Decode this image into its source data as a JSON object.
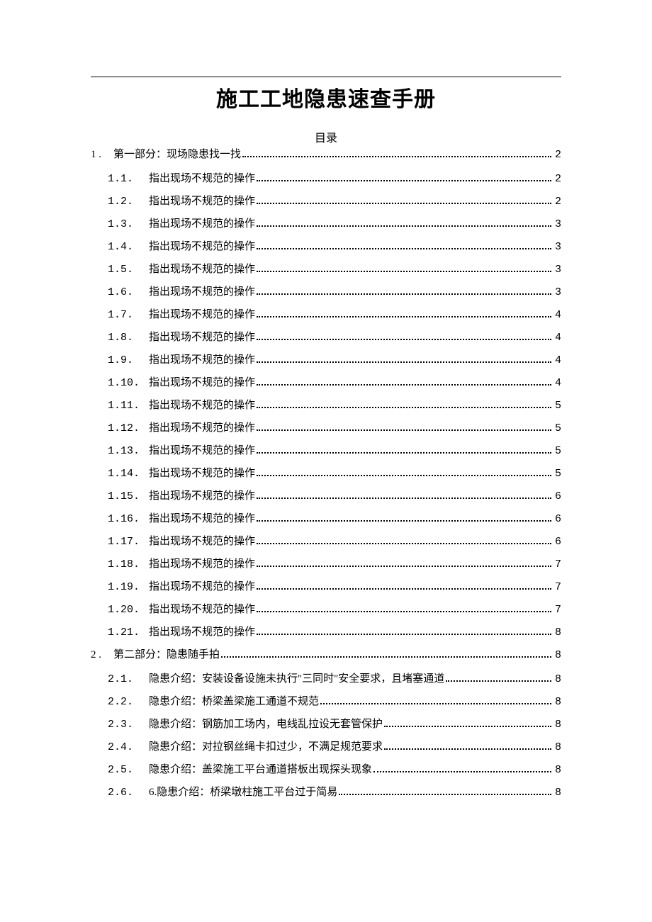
{
  "title": "施工工地隐患速查手册",
  "toc_caption": "目录",
  "toc": [
    {
      "lvl": 1,
      "num": "1 .",
      "txt": "第一部分：现场隐患找一找",
      "pg": "2"
    },
    {
      "lvl": 2,
      "num": "1.1.",
      "txt": "指出现场不规范的操作",
      "pg": "2"
    },
    {
      "lvl": 2,
      "num": "1.2.",
      "txt": "指出现场不规范的操作",
      "pg": "2"
    },
    {
      "lvl": 2,
      "num": "1.3.",
      "txt": "指出现场不规范的操作",
      "pg": "3"
    },
    {
      "lvl": 2,
      "num": "1.4.",
      "txt": "指出现场不规范的操作",
      "pg": "3"
    },
    {
      "lvl": 2,
      "num": "1.5.",
      "txt": "指出现场不规范的操作",
      "pg": "3"
    },
    {
      "lvl": 2,
      "num": "1.6.",
      "txt": "指出现场不规范的操作",
      "pg": "3"
    },
    {
      "lvl": 2,
      "num": "1.7.",
      "txt": "指出现场不规范的操作",
      "pg": "4"
    },
    {
      "lvl": 2,
      "num": "1.8.",
      "txt": "指出现场不规范的操作",
      "pg": "4"
    },
    {
      "lvl": 2,
      "num": "1.9.",
      "txt": "指出现场不规范的操作",
      "pg": "4"
    },
    {
      "lvl": 2,
      "num": "1.10.",
      "txt": "指出现场不规范的操作",
      "pg": "4"
    },
    {
      "lvl": 2,
      "num": "1.11.",
      "txt": "指出现场不规范的操作",
      "pg": "5"
    },
    {
      "lvl": 2,
      "num": "1.12.",
      "txt": "指出现场不规范的操作",
      "pg": "5"
    },
    {
      "lvl": 2,
      "num": "1.13.",
      "txt": "指出现场不规范的操作",
      "pg": "5"
    },
    {
      "lvl": 2,
      "num": "1.14.",
      "txt": "指出现场不规范的操作",
      "pg": "5"
    },
    {
      "lvl": 2,
      "num": "1.15.",
      "txt": "指出现场不规范的操作",
      "pg": "6"
    },
    {
      "lvl": 2,
      "num": "1.16.",
      "txt": "指出现场不规范的操作",
      "pg": "6"
    },
    {
      "lvl": 2,
      "num": "1.17.",
      "txt": "指出现场不规范的操作",
      "pg": "6"
    },
    {
      "lvl": 2,
      "num": "1.18.",
      "txt": "指出现场不规范的操作",
      "pg": "7"
    },
    {
      "lvl": 2,
      "num": "1.19.",
      "txt": "指出现场不规范的操作",
      "pg": "7"
    },
    {
      "lvl": 2,
      "num": "1.20.",
      "txt": "指出现场不规范的操作",
      "pg": "7"
    },
    {
      "lvl": 2,
      "num": "1.21.",
      "txt": "指出现场不规范的操作",
      "pg": "8"
    },
    {
      "lvl": 1,
      "num": "2 .",
      "txt": "第二部分：隐患随手拍",
      "pg": "8"
    },
    {
      "lvl": 2,
      "num": "2.1.",
      "txt": "隐患介绍：安装设备设施未执行\"三同时\"安全要求，且堵塞通道",
      "pg": "8"
    },
    {
      "lvl": 2,
      "num": "2.2.",
      "txt": "隐患介绍：桥梁盖梁施工通道不规范",
      "pg": "8"
    },
    {
      "lvl": 2,
      "num": "2.3.",
      "txt": "隐患介绍：钢筋加工场内，电线乱拉设无套管保护",
      "pg": "8"
    },
    {
      "lvl": 2,
      "num": "2.4.",
      "txt": "隐患介绍：对拉钢丝绳卡扣过少，不满足规范要求",
      "pg": "8"
    },
    {
      "lvl": 2,
      "num": "2.5.",
      "txt": "隐患介绍：盖梁施工平台通道搭板出现探头现象",
      "pg": "8"
    },
    {
      "lvl": 2,
      "num": "2.6.",
      "txt": "6.隐患介绍：桥梁墩柱施工平台过于简易",
      "pg": "8"
    }
  ]
}
